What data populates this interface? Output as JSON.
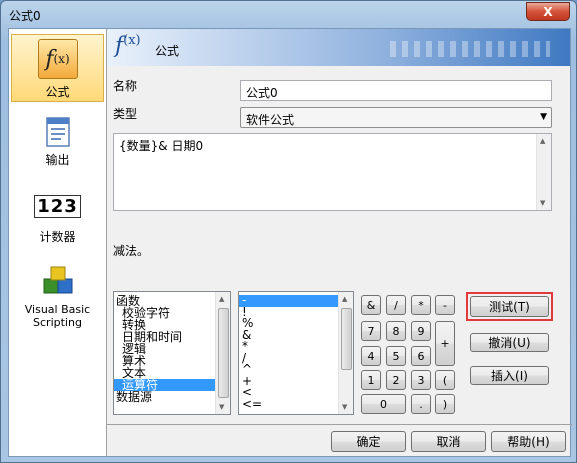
{
  "window": {
    "title": "公式0",
    "close_label": "X"
  },
  "sidebar": {
    "items": [
      {
        "label": "公式",
        "icon": "fx-icon"
      },
      {
        "label": "输出",
        "icon": "document-icon"
      },
      {
        "label": "计数器",
        "icon": "counter-icon",
        "icon_text": "123"
      },
      {
        "label": "Visual Basic Scripting",
        "icon": "vbs-blocks-icon"
      }
    ]
  },
  "banner": {
    "title": "公式",
    "fx_symbol": "f",
    "fx_paren": "(x)"
  },
  "form": {
    "name_label": "名称",
    "name_value": "公式0",
    "type_label": "类型",
    "type_value": "软件公式",
    "formula": "{数量}& 日期0",
    "description": "减法。"
  },
  "categories": [
    "函数",
    "校验字符",
    "转换",
    "日期和时间",
    "逻辑",
    "算术",
    "文本",
    "运算符",
    "数据源"
  ],
  "operators": [
    "-",
    "!",
    "%",
    "&",
    "*",
    "/",
    "^",
    "+",
    "<",
    "<="
  ],
  "keypad": {
    "amp": "&",
    "slash": "/",
    "star": "*",
    "minus": "-",
    "n7": "7",
    "n8": "8",
    "n9": "9",
    "plus": "+",
    "n4": "4",
    "n5": "5",
    "n6": "6",
    "n1": "1",
    "n2": "2",
    "n3": "3",
    "lparen": "(",
    "n0": "0",
    "dot": ".",
    "rparen": ")"
  },
  "actions": {
    "test": "测试(T)",
    "undo": "撤消(U)",
    "insert": "插入(I)"
  },
  "footer": {
    "ok": "确定",
    "cancel": "取消",
    "help": "帮助(H)"
  }
}
